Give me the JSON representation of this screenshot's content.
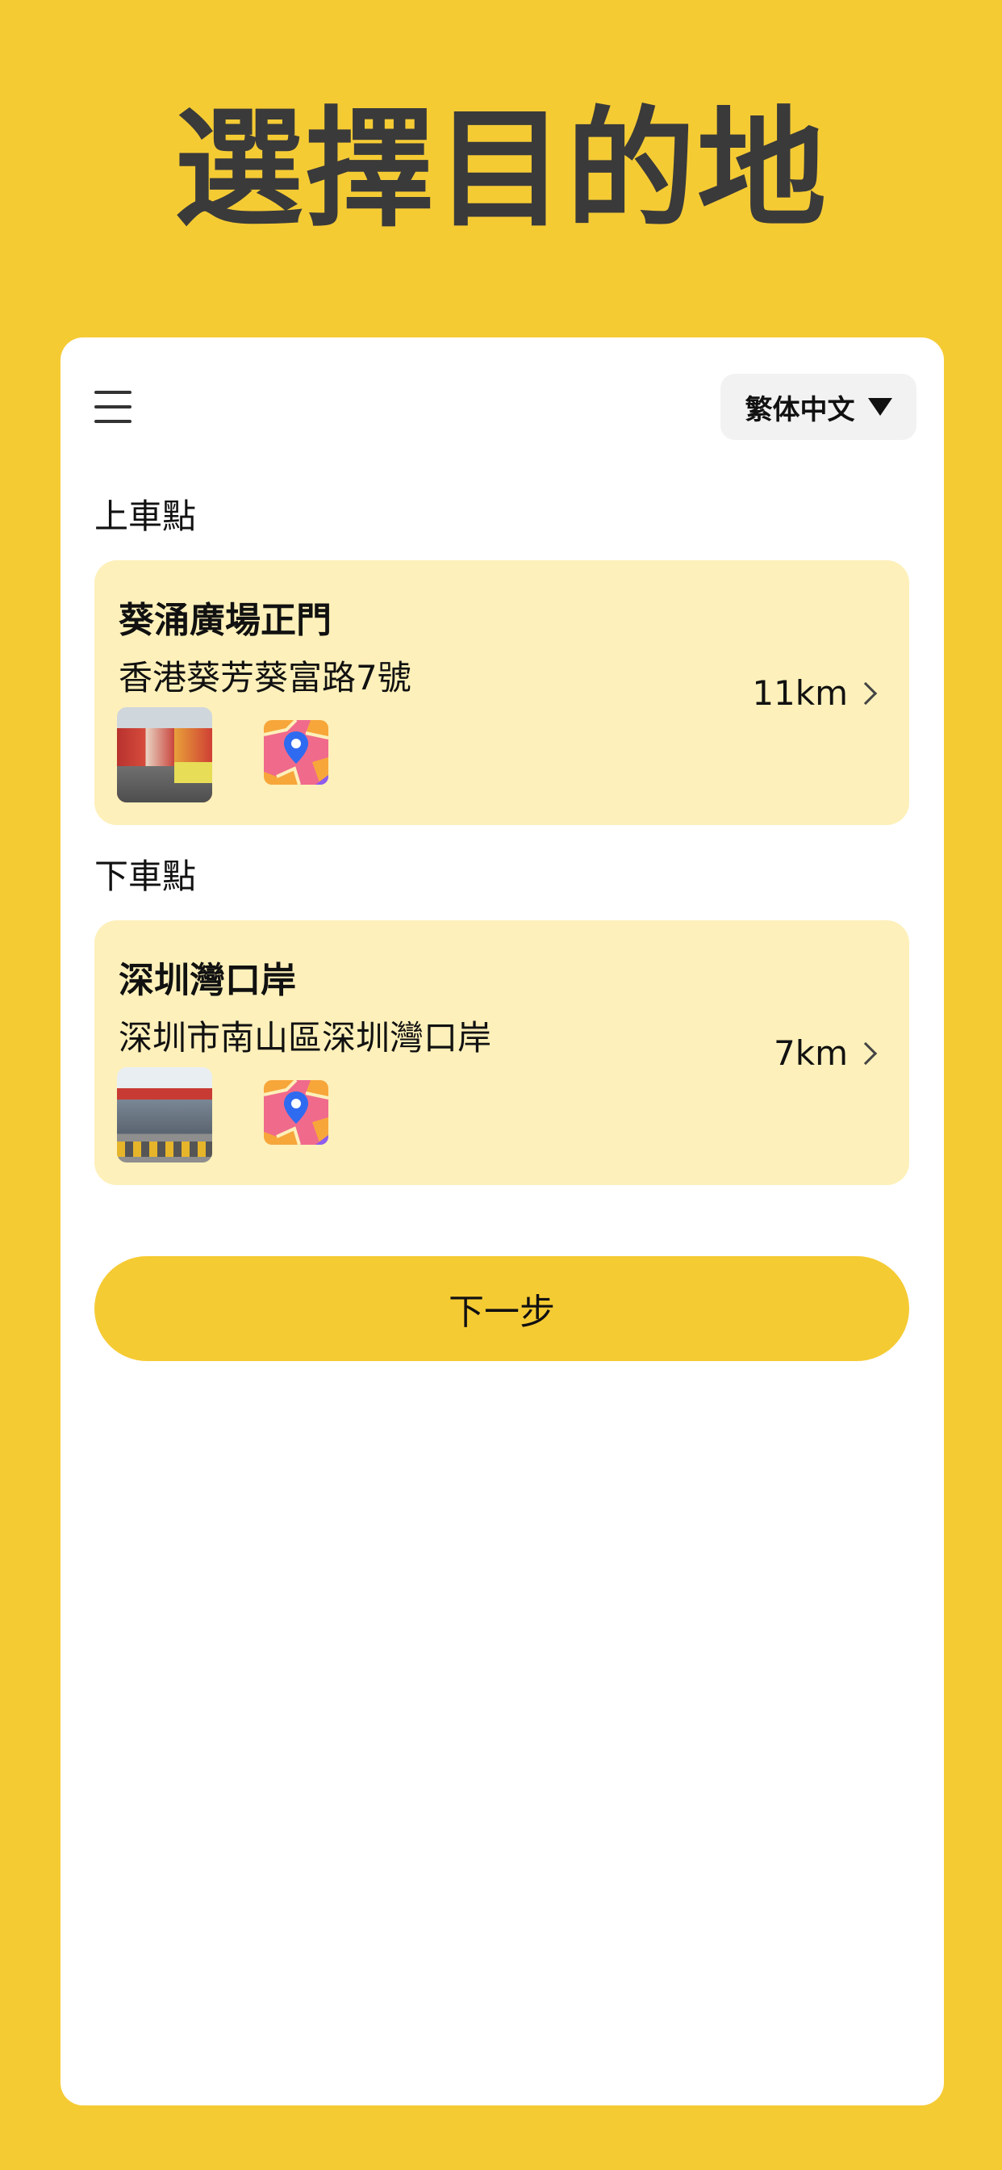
{
  "page": {
    "title": "選擇目的地"
  },
  "header": {
    "language": "繁体中文"
  },
  "pickup": {
    "section_label": "上車點",
    "name": "葵涌廣場正門",
    "address": "香港葵芳葵富路7號",
    "distance": "11km"
  },
  "dropoff": {
    "section_label": "下車點",
    "name": "深圳灣口岸",
    "address": "深圳市南山區深圳灣口岸",
    "distance": "7km"
  },
  "actions": {
    "next_label": "下一步"
  },
  "colors": {
    "background": "#F5CB34",
    "card": "#FFFFFF",
    "location_card": "#FDF0BA",
    "button": "#F5CB34"
  }
}
